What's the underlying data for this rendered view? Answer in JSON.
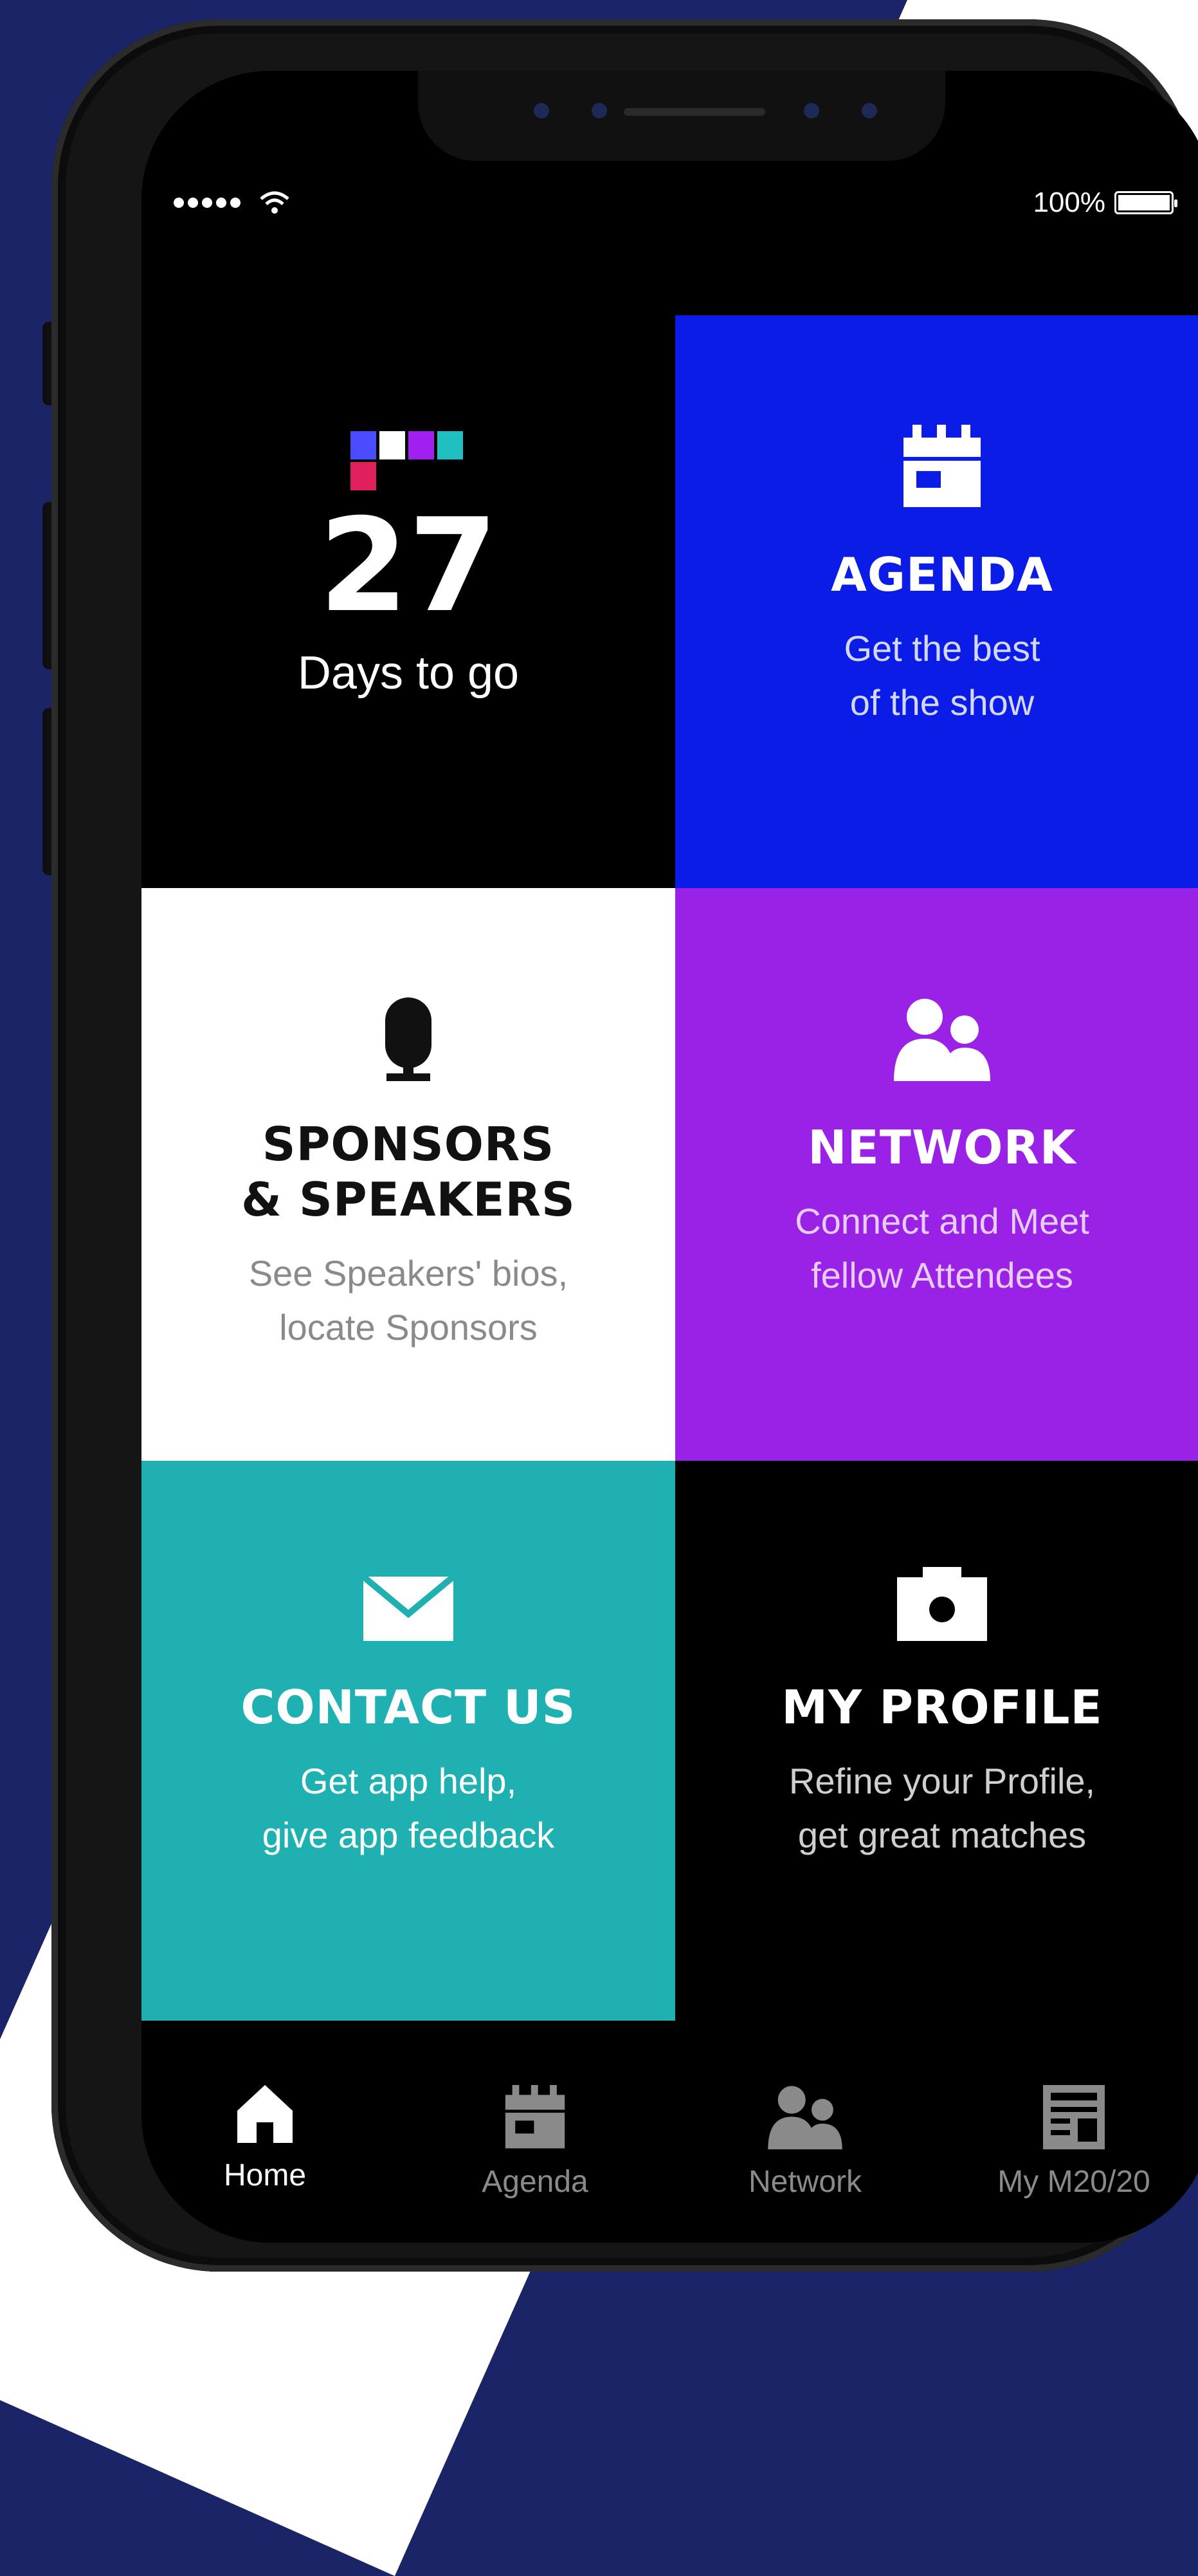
{
  "colors": {
    "background": "#1a2466",
    "agenda": "#0a1ce6",
    "network": "#9a22e6",
    "contact": "#1fb1b1",
    "nav_active": "#ffffff",
    "nav_inactive": "#8a8a8a"
  },
  "status_bar": {
    "battery": "100%"
  },
  "countdown": {
    "number": "27",
    "label": "Days to go"
  },
  "tiles": {
    "agenda": {
      "icon": "calendar-icon",
      "title": "AGENDA",
      "sub1": "Get the best",
      "sub2": "of the show"
    },
    "sponsors": {
      "icon": "microphone-icon",
      "title1": "SPONSORS",
      "title2": "& SPEAKERS",
      "sub1": "See Speakers' bios,",
      "sub2": "locate Sponsors"
    },
    "network": {
      "icon": "people-icon",
      "title": "NETWORK",
      "sub1": "Connect and Meet",
      "sub2": "fellow Attendees"
    },
    "contact": {
      "icon": "envelope-icon",
      "title": "CONTACT US",
      "sub1": "Get app help,",
      "sub2": "give app feedback"
    },
    "profile": {
      "icon": "camera-icon",
      "title": "MY PROFILE",
      "sub1": "Refine your Profile,",
      "sub2": "get great matches"
    }
  },
  "bottom_nav": [
    {
      "label": "Home",
      "icon": "home-icon",
      "active": true
    },
    {
      "label": "Agenda",
      "icon": "calendar-icon",
      "active": false
    },
    {
      "label": "Network",
      "icon": "people-icon",
      "active": false
    },
    {
      "label": "My M20/20",
      "icon": "news-icon",
      "active": false
    }
  ]
}
